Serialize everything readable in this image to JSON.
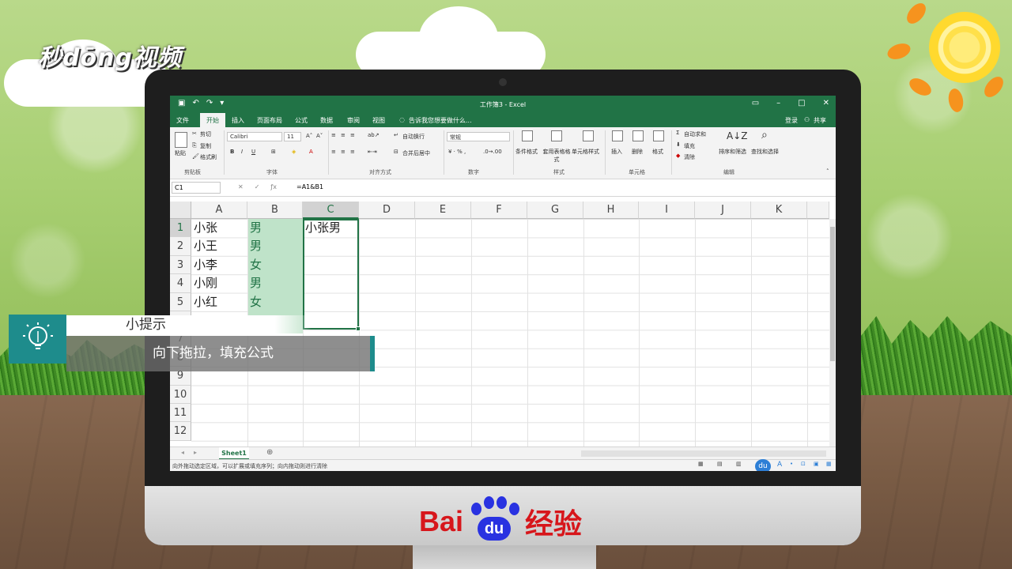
{
  "branding": {
    "top_logo": "秒dōng视频",
    "bottom_logo_left": "Bai",
    "bottom_logo_paw": "du",
    "bottom_logo_right": "经验"
  },
  "excel": {
    "title": "工作簿3 - Excel",
    "quick_access": [
      "save-icon",
      "undo-icon",
      "redo-icon",
      "customize-icon"
    ],
    "window_controls": [
      "restore-ribbon-icon",
      "minimize-icon",
      "maximize-icon",
      "close-icon"
    ],
    "tabs": [
      "文件",
      "开始",
      "插入",
      "页面布局",
      "公式",
      "数据",
      "审阅",
      "视图"
    ],
    "active_tab": "开始",
    "tell_me": "告诉我您想要做什么...",
    "signin": "登录",
    "share": "共享",
    "ribbon": {
      "clipboard": {
        "paste": "粘贴",
        "cut": "剪切",
        "copy": "复制",
        "format_painter": "格式刷",
        "label": "剪贴板"
      },
      "font": {
        "font_name": "Calibri",
        "font_size": "11",
        "bold": "B",
        "italic": "I",
        "underline": "U",
        "label": "字体"
      },
      "alignment": {
        "wrap": "自动换行",
        "merge": "合并后居中",
        "label": "对齐方式"
      },
      "number": {
        "format": "常规",
        "label": "数字"
      },
      "styles": {
        "conditional": "条件格式",
        "table": "套用表格格式",
        "cell_styles": "单元格样式",
        "label": "样式"
      },
      "cells": {
        "insert": "插入",
        "delete": "删除",
        "format": "格式",
        "label": "单元格"
      },
      "editing": {
        "autosum": "自动求和",
        "fill": "填充",
        "clear": "清除",
        "sort": "排序和筛选",
        "find": "查找和选择",
        "label": "编辑"
      }
    },
    "name_box": "C1",
    "formula": "=A1&B1",
    "columns": [
      "A",
      "B",
      "C",
      "D",
      "E",
      "F",
      "G",
      "H",
      "I",
      "J",
      "K"
    ],
    "selected_column": "C",
    "rows": [
      "1",
      "2",
      "3",
      "4",
      "5",
      "6",
      "7",
      "8",
      "9",
      "10",
      "11",
      "12"
    ],
    "selected_row": "1",
    "cells": {
      "A1": "小张",
      "B1": "男",
      "C1": "小张男",
      "A2": "小王",
      "B2": "男",
      "A3": "小李",
      "B3": "女",
      "A4": "小刚",
      "B4": "男",
      "A5": "小红",
      "B5": "女"
    },
    "sheet_tab": "Sheet1",
    "add_sheet": "⊕",
    "status_text": "向外拖动选定区域，可以扩展或填充序列；向内拖动则进行清除",
    "colors": {
      "accent": "#217346",
      "fill_b": "#bfe3c9"
    }
  },
  "tip": {
    "icon": "lightbulb-icon",
    "title": "小提示",
    "body": "向下拖拉，填充公式",
    "accent": "#1e8c8c"
  }
}
